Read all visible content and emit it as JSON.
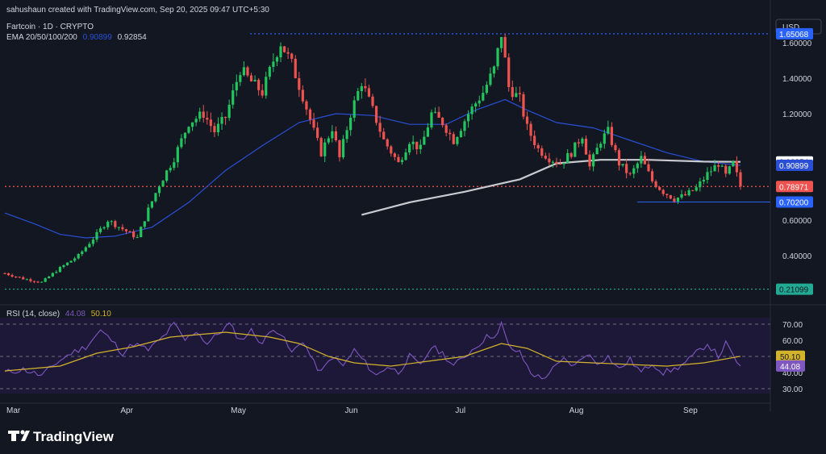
{
  "header": {
    "created_by": "sahushaun created with TradingView.com, Sep 20, 2025 09:47 UTC+5:30",
    "symbol_line": "Fartcoin · 1D · CRYPTO",
    "ema_label": "EMA 20/50/100/200",
    "ema_value_1": "0.90899",
    "ema_value_2": "0.92854"
  },
  "currency": "USD",
  "brand": "TradingView",
  "colors": {
    "bg": "#131722",
    "up": "#26a69a",
    "up_bright": "#22c55e",
    "down": "#ef5350",
    "ema_blue": "#2a4fd6",
    "ema_white": "#c8cad0",
    "rsi_line": "#7e57c2",
    "rsi_ma": "#d4b32c",
    "dotted_blue": "#2962ff",
    "dotted_green": "#22ab94"
  },
  "chart_data": [
    {
      "type": "candlestick",
      "y_scale": "linear",
      "ylim": [
        0.15,
        1.75
      ],
      "y_ticks": [
        {
          "value": 1.6,
          "label": "1.60000"
        },
        {
          "value": 1.4,
          "label": "1.40000"
        },
        {
          "value": 1.2,
          "label": "1.20000"
        },
        {
          "value": 0.6,
          "label": "0.60000"
        },
        {
          "value": 0.4,
          "label": "0.40000"
        }
      ],
      "x_ticks": [
        {
          "day": 0,
          "label": "Mar"
        },
        {
          "day": 31,
          "label": "Apr"
        },
        {
          "day": 61,
          "label": "May"
        },
        {
          "day": 92,
          "label": "Jun"
        },
        {
          "day": 122,
          "label": "Jul"
        },
        {
          "day": 153,
          "label": "Aug"
        },
        {
          "day": 184,
          "label": "Sep"
        }
      ],
      "price_levels": [
        {
          "value": 1.65068,
          "label": "1.65068",
          "style": "dotted",
          "color": "#2962ff",
          "bg": "#2962ff",
          "fg": "#ffffff"
        },
        {
          "value": 0.92854,
          "label": "0.92854",
          "style": "none",
          "color": "#c8cad0",
          "bg": "#ffffff",
          "fg": "#131722"
        },
        {
          "value": 0.90899,
          "label": "0.90899",
          "style": "none",
          "color": "#2a4fd6",
          "bg": "#2a4fd6",
          "fg": "#ffffff"
        },
        {
          "value": 0.78971,
          "label": "0.78971",
          "style": "dotted",
          "color": "#ef5350",
          "bg": "#ef5350",
          "fg": "#ffffff"
        },
        {
          "value": 0.702,
          "label": "0.70200",
          "style": "solid",
          "color": "#2962ff",
          "bg": "#2962ff",
          "fg": "#ffffff"
        },
        {
          "value": 0.21099,
          "label": "0.21099",
          "style": "dotted",
          "color": "#22ab94",
          "bg": "#22ab94",
          "fg": "#131722"
        }
      ],
      "close_anchors": [
        [
          0,
          0.3
        ],
        [
          5,
          0.27
        ],
        [
          10,
          0.25
        ],
        [
          15,
          0.33
        ],
        [
          20,
          0.4
        ],
        [
          25,
          0.52
        ],
        [
          28,
          0.6
        ],
        [
          32,
          0.55
        ],
        [
          36,
          0.5
        ],
        [
          39,
          0.66
        ],
        [
          42,
          0.8
        ],
        [
          46,
          0.95
        ],
        [
          50,
          1.15
        ],
        [
          54,
          1.2
        ],
        [
          57,
          1.1
        ],
        [
          60,
          1.18
        ],
        [
          64,
          1.45
        ],
        [
          67,
          1.38
        ],
        [
          70,
          1.32
        ],
        [
          73,
          1.5
        ],
        [
          75,
          1.6
        ],
        [
          78,
          1.48
        ],
        [
          81,
          1.3
        ],
        [
          84,
          1.1
        ],
        [
          86,
          0.98
        ],
        [
          89,
          1.12
        ],
        [
          91,
          0.95
        ],
        [
          94,
          1.2
        ],
        [
          97,
          1.38
        ],
        [
          100,
          1.22
        ],
        [
          103,
          1.05
        ],
        [
          107,
          0.92
        ],
        [
          110,
          1.05
        ],
        [
          113,
          1.0
        ],
        [
          116,
          1.2
        ],
        [
          119,
          1.15
        ],
        [
          122,
          1.05
        ],
        [
          126,
          1.2
        ],
        [
          130,
          1.32
        ],
        [
          133,
          1.45
        ],
        [
          135,
          1.65
        ],
        [
          137,
          1.35
        ],
        [
          140,
          1.28
        ],
        [
          142,
          1.12
        ],
        [
          145,
          1.0
        ],
        [
          148,
          0.95
        ],
        [
          151,
          0.92
        ],
        [
          154,
          0.98
        ],
        [
          157,
          1.08
        ],
        [
          159,
          0.9
        ],
        [
          162,
          1.05
        ],
        [
          164,
          1.1
        ],
        [
          167,
          0.92
        ],
        [
          170,
          0.85
        ],
        [
          173,
          0.95
        ],
        [
          176,
          0.82
        ],
        [
          179,
          0.76
        ],
        [
          182,
          0.72
        ],
        [
          185,
          0.74
        ],
        [
          188,
          0.78
        ],
        [
          191,
          0.86
        ],
        [
          194,
          0.92
        ],
        [
          196,
          0.85
        ],
        [
          198,
          0.92
        ],
        [
          200,
          0.79
        ]
      ],
      "ema200": [
        [
          97,
          0.63
        ],
        [
          110,
          0.7
        ],
        [
          125,
          0.76
        ],
        [
          140,
          0.83
        ],
        [
          150,
          0.92
        ],
        [
          162,
          0.94
        ],
        [
          175,
          0.94
        ],
        [
          190,
          0.93
        ],
        [
          200,
          0.92854
        ]
      ],
      "ema_blue": [
        [
          0,
          0.64
        ],
        [
          8,
          0.58
        ],
        [
          15,
          0.52
        ],
        [
          22,
          0.5
        ],
        [
          30,
          0.51
        ],
        [
          40,
          0.56
        ],
        [
          50,
          0.7
        ],
        [
          60,
          0.88
        ],
        [
          70,
          1.02
        ],
        [
          80,
          1.15
        ],
        [
          90,
          1.2
        ],
        [
          100,
          1.19
        ],
        [
          110,
          1.14
        ],
        [
          120,
          1.14
        ],
        [
          128,
          1.22
        ],
        [
          136,
          1.28
        ],
        [
          142,
          1.22
        ],
        [
          150,
          1.15
        ],
        [
          160,
          1.12
        ],
        [
          170,
          1.05
        ],
        [
          180,
          0.98
        ],
        [
          190,
          0.93
        ],
        [
          200,
          0.90899
        ]
      ]
    },
    {
      "type": "line",
      "name": "RSI (14, close)",
      "title": "RSI (14, close)",
      "values_label_1": "44.08",
      "values_label_2": "50.10",
      "ylim": [
        27,
        74
      ],
      "y_ticks": [
        {
          "value": 70,
          "label": "70.00"
        },
        {
          "value": 60,
          "label": "60.00"
        },
        {
          "value": 40,
          "label": "40.00"
        },
        {
          "value": 30,
          "label": "30.00"
        }
      ],
      "bands": [
        70,
        50,
        30
      ],
      "rsi_anchors": [
        [
          0,
          40
        ],
        [
          5,
          42
        ],
        [
          10,
          38
        ],
        [
          14,
          46
        ],
        [
          18,
          52
        ],
        [
          22,
          56
        ],
        [
          26,
          66
        ],
        [
          29,
          60
        ],
        [
          32,
          52
        ],
        [
          35,
          58
        ],
        [
          39,
          54
        ],
        [
          43,
          62
        ],
        [
          46,
          70
        ],
        [
          49,
          60
        ],
        [
          52,
          66
        ],
        [
          55,
          58
        ],
        [
          58,
          64
        ],
        [
          61,
          70
        ],
        [
          64,
          60
        ],
        [
          67,
          66
        ],
        [
          70,
          58
        ],
        [
          73,
          68
        ],
        [
          75,
          64
        ],
        [
          78,
          52
        ],
        [
          81,
          60
        ],
        [
          84,
          46
        ],
        [
          86,
          40
        ],
        [
          89,
          50
        ],
        [
          92,
          44
        ],
        [
          95,
          54
        ],
        [
          98,
          46
        ],
        [
          101,
          38
        ],
        [
          104,
          44
        ],
        [
          107,
          40
        ],
        [
          110,
          50
        ],
        [
          113,
          44
        ],
        [
          116,
          56
        ],
        [
          119,
          52
        ],
        [
          122,
          44
        ],
        [
          125,
          50
        ],
        [
          128,
          56
        ],
        [
          131,
          62
        ],
        [
          134,
          64
        ],
        [
          135,
          70
        ],
        [
          137,
          56
        ],
        [
          140,
          52
        ],
        [
          143,
          40
        ],
        [
          146,
          36
        ],
        [
          149,
          42
        ],
        [
          152,
          48
        ],
        [
          155,
          44
        ],
        [
          158,
          52
        ],
        [
          161,
          46
        ],
        [
          164,
          50
        ],
        [
          167,
          42
        ],
        [
          170,
          48
        ],
        [
          173,
          40
        ],
        [
          176,
          46
        ],
        [
          179,
          40
        ],
        [
          182,
          42
        ],
        [
          185,
          46
        ],
        [
          188,
          52
        ],
        [
          191,
          58
        ],
        [
          194,
          50
        ],
        [
          196,
          58
        ],
        [
          198,
          50
        ],
        [
          200,
          44.08
        ]
      ],
      "rsi_ma_anchors": [
        [
          0,
          41
        ],
        [
          15,
          44
        ],
        [
          25,
          52
        ],
        [
          35,
          56
        ],
        [
          45,
          62
        ],
        [
          60,
          65
        ],
        [
          72,
          62
        ],
        [
          80,
          58
        ],
        [
          88,
          50
        ],
        [
          95,
          46
        ],
        [
          105,
          44
        ],
        [
          115,
          47
        ],
        [
          125,
          50
        ],
        [
          135,
          58
        ],
        [
          142,
          55
        ],
        [
          150,
          47
        ],
        [
          160,
          46
        ],
        [
          170,
          45
        ],
        [
          180,
          44
        ],
        [
          190,
          46
        ],
        [
          200,
          50.1
        ]
      ]
    }
  ]
}
